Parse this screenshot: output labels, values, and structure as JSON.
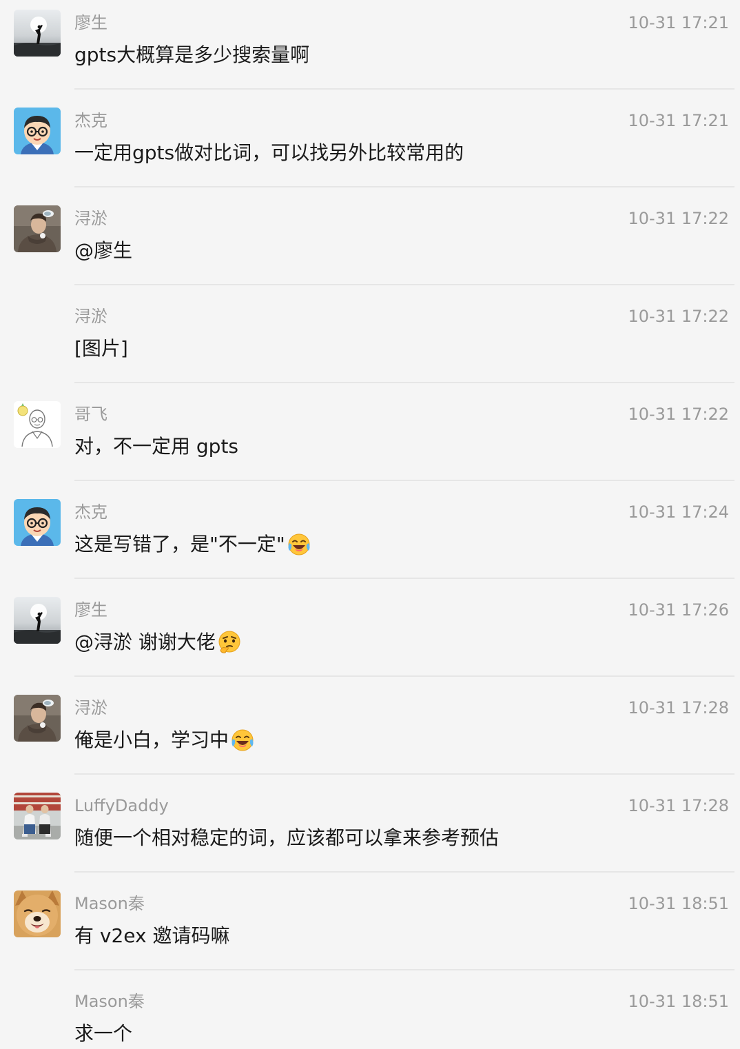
{
  "messages": [
    {
      "sender": "廖生",
      "time": "10-31 17:21",
      "text": "gpts大概算是多少搜索量啊",
      "avatar": "sunset-figure-avatar"
    },
    {
      "sender": "杰克",
      "time": "10-31 17:21",
      "text": "一定用gpts做对比词，可以找另外比较常用的",
      "avatar": "cartoon-glasses-avatar"
    },
    {
      "sender": "浔淤",
      "time": "10-31 17:22",
      "text": "@廖生",
      "avatar": "hoodie-person-avatar"
    },
    {
      "sender": "浔淤",
      "time": "10-31 17:22",
      "text": "[图片]",
      "avatar": ""
    },
    {
      "sender": "哥飞",
      "time": "10-31 17:22",
      "text": "对，不一定用 gpts",
      "avatar": "sketch-bald-avatar"
    },
    {
      "sender": "杰克",
      "time": "10-31 17:24",
      "text": "这是写错了，是\"不一定\"",
      "avatar": "cartoon-glasses-avatar",
      "emoji": "laughing-tears-emoji"
    },
    {
      "sender": "廖生",
      "time": "10-31 17:26",
      "text": "@浔淤 谢谢大佬",
      "avatar": "sunset-figure-avatar",
      "emoji": "thinking-glance-emoji"
    },
    {
      "sender": "浔淤",
      "time": "10-31 17:28",
      "text": "俺是小白，学习中",
      "avatar": "hoodie-person-avatar",
      "emoji": "laughing-tears-emoji"
    },
    {
      "sender": "LuffyDaddy",
      "time": "10-31 17:28",
      "text": "随便一个相对稳定的词，应该都可以拿来参考预估",
      "avatar": "couple-photo-avatar"
    },
    {
      "sender": "Mason秦",
      "time": "10-31 18:51",
      "text": "有 v2ex 邀请码嘛",
      "avatar": "shiba-dog-avatar"
    },
    {
      "sender": "Mason秦",
      "time": "10-31 18:51",
      "text": "求一个",
      "avatar": ""
    }
  ]
}
